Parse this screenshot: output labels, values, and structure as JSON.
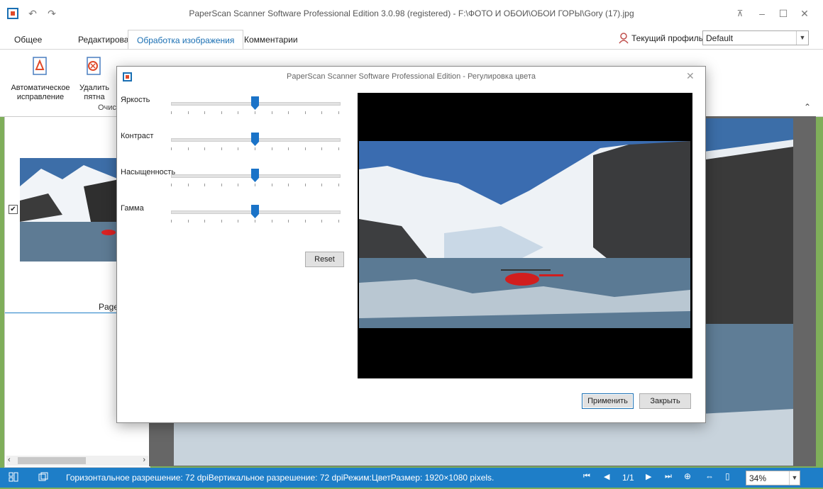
{
  "window": {
    "title": "PaperScan Scanner Software Professional Edition 3.0.98 (registered) - F:\\ФОТО И ОБОИ\\ОБОИ ГОРЫ\\Gory (17).jpg"
  },
  "tabs": [
    {
      "label": "Общее"
    },
    {
      "label": "Редактирование"
    },
    {
      "label": "Обработка изображения"
    },
    {
      "label": "Комментарии"
    }
  ],
  "profile": {
    "label": "Текущий профиль:",
    "value": "Default"
  },
  "ribbon": {
    "auto_fix_line1": "Автоматическое",
    "auto_fix_line2": "исправление",
    "remove_spots_line1": "Удалить",
    "remove_spots_line2": "пятна",
    "group_label_partial": "Очис"
  },
  "left_panel": {
    "page_label_partial": "Page"
  },
  "dialog": {
    "title": "PaperScan Scanner Software Professional Edition - Регулировка цвета",
    "sliders": [
      {
        "label": "Яркость",
        "value": 0.5
      },
      {
        "label": "Контраст",
        "value": 0.5
      },
      {
        "label": "Насыщенность",
        "value": 0.5
      },
      {
        "label": "Гамма",
        "value": 0.5
      }
    ],
    "reset_label": "Reset",
    "apply_label": "Применить",
    "close_label": "Закрыть"
  },
  "statusbar": {
    "info": "Горизонтальное разрешение: 72 dpiВертикальное разрешение: 72 dpiРежим:ЦветРазмер: 1920×1080 pixels.",
    "page": "1/1",
    "zoom": "34%"
  },
  "colors": {
    "accent": "#1e7ec8",
    "slider_thumb": "#1a73c8"
  }
}
